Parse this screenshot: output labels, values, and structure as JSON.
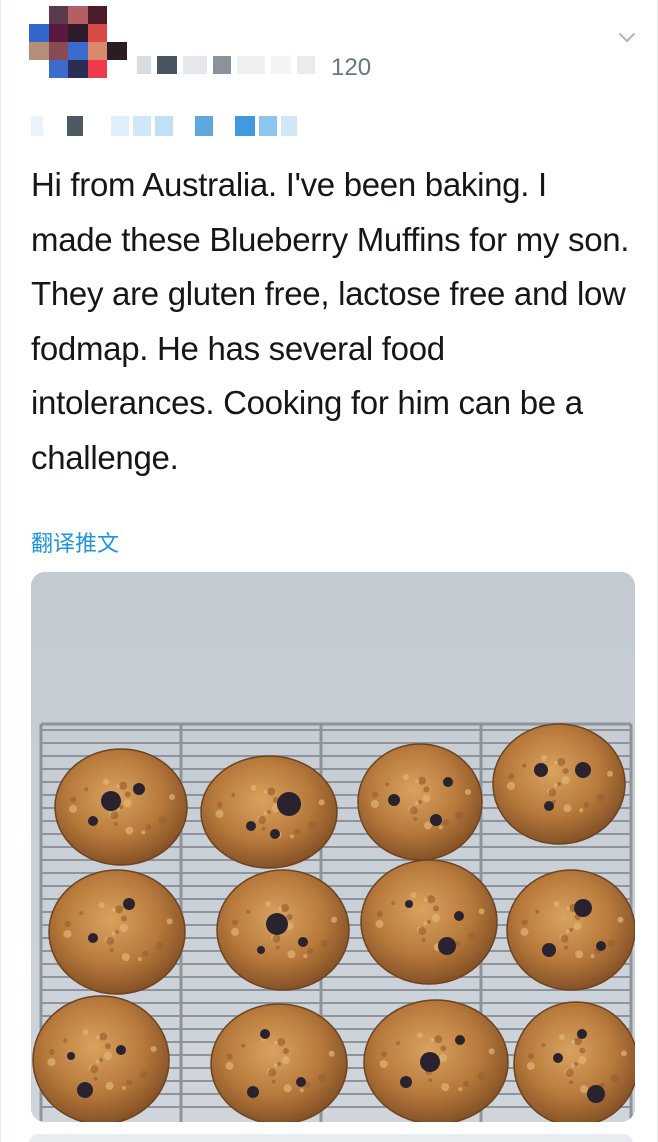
{
  "header": {
    "handle_visible_suffix": "120",
    "avatar_colors": [
      [
        "#ffffff",
        "#5a3b4c",
        "#b35f63",
        "#4b1d2c",
        "#ffffff"
      ],
      [
        "#3366cc",
        "#5a1840",
        "#2d1a2b",
        "#d94c45",
        "#ffffff"
      ],
      [
        "#b58e7a",
        "#8a4a52",
        "#3c6bd0",
        "#d98a6e",
        "#2b1c24"
      ],
      [
        "#ffffff",
        "#3c6bd0",
        "#2a2d55",
        "#ee3a4b",
        "#ffffff"
      ],
      [
        "#ffffff",
        "#ffffff",
        "#ffffff",
        "#ffffff",
        "#ffffff"
      ]
    ]
  },
  "tweet": {
    "text": "Hi from Australia. I've been baking. I made these Blueberry Muffins for my son. They are gluten free, lactose free and low fodmap. He has several food intolerances. Cooking for him can be a challenge.",
    "translate_label": "翻译推文"
  },
  "media": {
    "description_icon": "photo-icon",
    "colors": {
      "background": "#c8cfd6",
      "rack": "#9aa0a6",
      "muffin": "#b87a3c",
      "muffin_dark": "#8a5528",
      "blueberry": "#2b2230"
    }
  }
}
